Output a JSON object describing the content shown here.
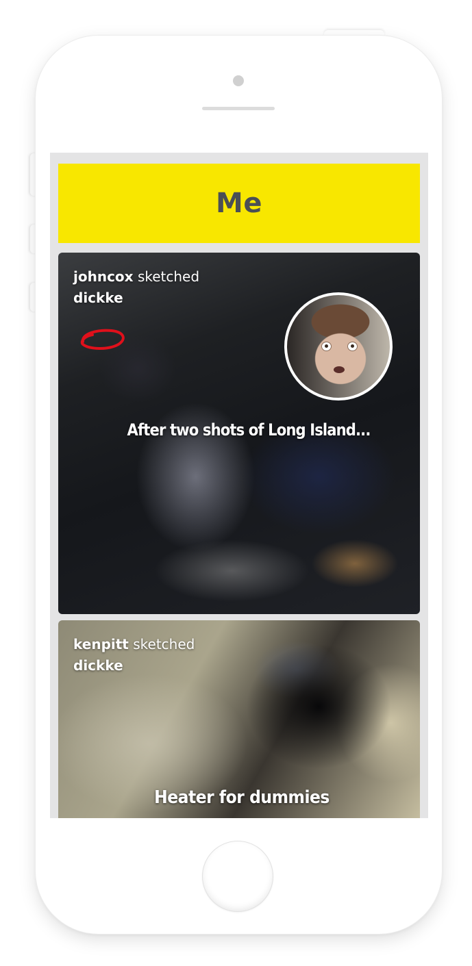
{
  "header": {
    "title": "Me"
  },
  "feed": [
    {
      "username": "johncox",
      "verb": "sketched",
      "subject": "dickke",
      "caption": "After two shots of Long Island...",
      "sketch_color": "#e0101b"
    },
    {
      "username": "kenpitt",
      "verb": "sketched",
      "subject": "dickke",
      "caption": "Heater for dummies"
    }
  ],
  "colors": {
    "header_background": "#f8e700",
    "header_text": "#4a4f55",
    "screen_background": "#e4e4e5"
  }
}
